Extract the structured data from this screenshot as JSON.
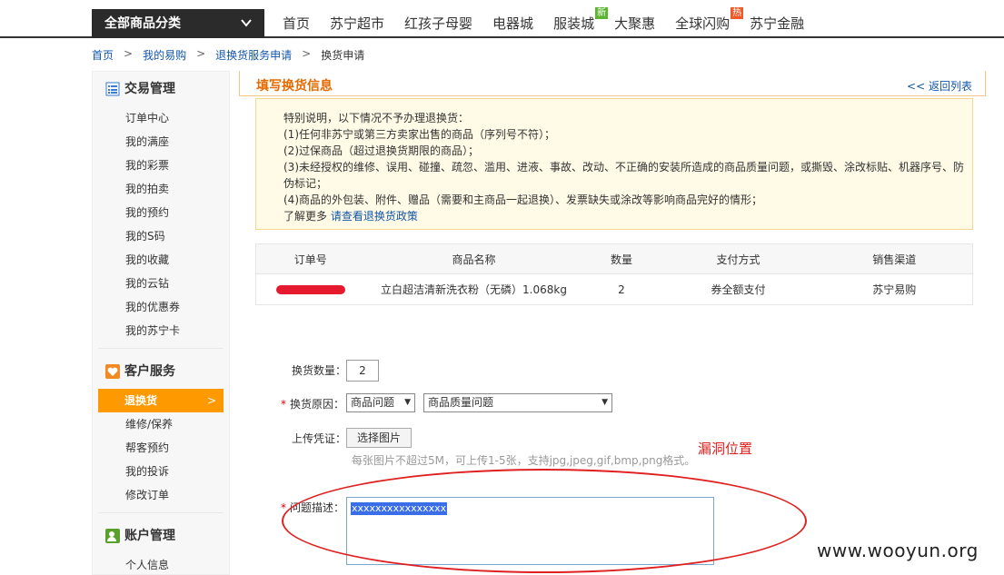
{
  "topnav": {
    "all_categories": "全部商品分类",
    "items": [
      {
        "label": "首页",
        "badge": ""
      },
      {
        "label": "苏宁超市",
        "badge": ""
      },
      {
        "label": "红孩子母婴",
        "badge": ""
      },
      {
        "label": "电器城",
        "badge": ""
      },
      {
        "label": "服装城",
        "badge": "新"
      },
      {
        "label": "大聚惠",
        "badge": ""
      },
      {
        "label": "全球闪购",
        "badge": "热"
      },
      {
        "label": "苏宁金融",
        "badge": ""
      }
    ]
  },
  "breadcrumb": {
    "items": [
      "首页",
      "我的易购",
      "退换货服务申请"
    ],
    "current": "换货申请"
  },
  "sidebar": {
    "trade": {
      "title": "交易管理",
      "items": [
        "订单中心",
        "我的满座",
        "我的彩票",
        "我的拍卖",
        "我的预约",
        "我的S码",
        "我的收藏",
        "我的云钻",
        "我的优惠券",
        "我的苏宁卡"
      ]
    },
    "service": {
      "title": "客户服务",
      "active": "退换货",
      "items": [
        "维修/保养",
        "帮客预约",
        "我的投诉",
        "修改订单"
      ]
    },
    "account": {
      "title": "账户管理",
      "items": [
        "个人信息"
      ]
    }
  },
  "main": {
    "title": "填写换货信息",
    "back": "返回列表",
    "notice": {
      "lines": [
        "特别说明，以下情况不予办理退换货：",
        "(1)任何非苏宁或第三方卖家出售的商品（序列号不符）；",
        "(2)过保商品（超过退换货期限的商品）；",
        "(3)未经授权的维修、误用、碰撞、疏忽、滥用、进液、事故、改动、不正确的安装所造成的商品质量问题，或撕毁、涂改标贴、机器序号、防伪标记；",
        "(4)商品的外包装、附件、赠品（需要和主商品一起退换）、发票缺失或涂改等影响商品完好的情形；"
      ],
      "more_prefix": "了解更多",
      "more_link": "请查看退换货政策"
    },
    "table": {
      "headers": [
        "订单号",
        "商品名称",
        "数量",
        "支付方式",
        "销售渠道"
      ],
      "row": {
        "product": "立白超洁清新洗衣粉（无磷）1.068kg",
        "qty": "2",
        "payment": "券全额支付",
        "channel": "苏宁易购"
      }
    },
    "form": {
      "qty_label": "换货数量：",
      "qty_value": "2",
      "reason_label": "换货原因：",
      "reason_value": "商品问题",
      "reason_detail": "商品质量问题",
      "upload_label": "上传凭证：",
      "upload_button": "选择图片",
      "upload_hint": "每张图片不超过5M，可上传1-5张，支持jpg,jpeg,gif,bmp,png格式。",
      "desc_label": "问题描述：",
      "desc_value": "xxxxxxxxxxxxxxxx"
    }
  },
  "annotation": {
    "label": "漏洞位置"
  },
  "watermark": "www.wooyun.org"
}
